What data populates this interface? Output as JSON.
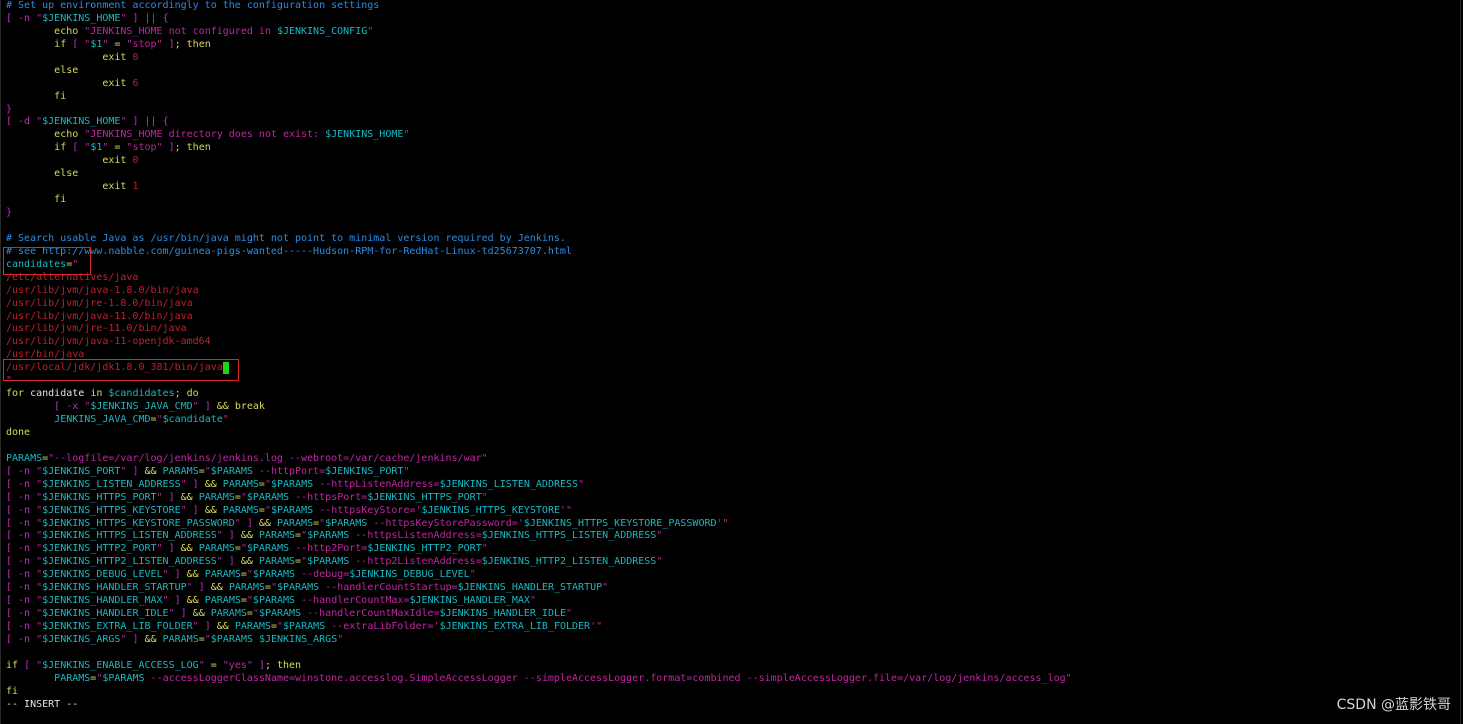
{
  "editor": {
    "mode_label": "-- INSERT --",
    "colors": {
      "background": "#000000",
      "comment": "#2b8ce6",
      "bracket": "#bd2fbd",
      "keyword": "#d9d95a",
      "string": "#c026a0",
      "variable": "#19b9c3",
      "java_path": "#c2212b",
      "cursor": "#1fd11f",
      "highlight_box": "#d42a2a"
    },
    "lines": [
      [
        [
          "cm",
          "# Set up environment accordingly to the configuration settings"
        ]
      ],
      [
        [
          "br",
          "[ -n "
        ],
        [
          "str",
          "\""
        ],
        [
          "var",
          "$JENKINS_HOME"
        ],
        [
          "str",
          "\""
        ],
        [
          "br",
          " ] || {"
        ]
      ],
      [
        [
          "w",
          "        "
        ],
        [
          "kw",
          "echo "
        ],
        [
          "str",
          "\"JENKINS_HOME not configured in "
        ],
        [
          "var",
          "$JENKINS_CONFIG"
        ],
        [
          "str",
          "\""
        ]
      ],
      [
        [
          "w",
          "        "
        ],
        [
          "kw",
          "if "
        ],
        [
          "br",
          "[ "
        ],
        [
          "str",
          "\""
        ],
        [
          "var",
          "$1"
        ],
        [
          "str",
          "\""
        ],
        [
          "kw",
          " = "
        ],
        [
          "str",
          "\"stop\""
        ],
        [
          "br",
          " ]"
        ],
        [
          "kw",
          "; then"
        ]
      ],
      [
        [
          "w",
          "                "
        ],
        [
          "kw",
          "exit "
        ],
        [
          "red",
          "0"
        ]
      ],
      [
        [
          "w",
          "        "
        ],
        [
          "kw",
          "else"
        ]
      ],
      [
        [
          "w",
          "                "
        ],
        [
          "kw",
          "exit "
        ],
        [
          "red",
          "6"
        ]
      ],
      [
        [
          "w",
          "        "
        ],
        [
          "kw",
          "fi"
        ]
      ],
      [
        [
          "br",
          "}"
        ]
      ],
      [
        [
          "br",
          "[ -d "
        ],
        [
          "str",
          "\""
        ],
        [
          "var",
          "$JENKINS_HOME"
        ],
        [
          "str",
          "\""
        ],
        [
          "br",
          " ] || {"
        ]
      ],
      [
        [
          "w",
          "        "
        ],
        [
          "kw",
          "echo "
        ],
        [
          "str",
          "\"JENKINS_HOME directory does not exist: "
        ],
        [
          "var",
          "$JENKINS_HOME"
        ],
        [
          "str",
          "\""
        ]
      ],
      [
        [
          "w",
          "        "
        ],
        [
          "kw",
          "if "
        ],
        [
          "br",
          "[ "
        ],
        [
          "str",
          "\""
        ],
        [
          "var",
          "$1"
        ],
        [
          "str",
          "\""
        ],
        [
          "kw",
          " = "
        ],
        [
          "str",
          "\"stop\""
        ],
        [
          "br",
          " ]"
        ],
        [
          "kw",
          "; then"
        ]
      ],
      [
        [
          "w",
          "                "
        ],
        [
          "kw",
          "exit "
        ],
        [
          "red",
          "0"
        ]
      ],
      [
        [
          "w",
          "        "
        ],
        [
          "kw",
          "else"
        ]
      ],
      [
        [
          "w",
          "                "
        ],
        [
          "kw",
          "exit "
        ],
        [
          "red",
          "1"
        ]
      ],
      [
        [
          "w",
          "        "
        ],
        [
          "kw",
          "fi"
        ]
      ],
      [
        [
          "br",
          "}"
        ]
      ],
      [],
      [
        [
          "cm",
          "# Search usable Java as /usr/bin/java might not point to minimal version required by Jenkins."
        ]
      ],
      [
        [
          "cm",
          "# see http://www.nabble.com/guinea-pigs-wanted-----Hudson-RPM-for-RedHat-Linux-td25673707.html"
        ]
      ],
      [
        [
          "var",
          "candidates"
        ],
        [
          "kw",
          "="
        ],
        [
          "str",
          "\""
        ]
      ],
      [
        [
          "red",
          "/etc/alternatives/java"
        ]
      ],
      [
        [
          "red",
          "/usr/lib/jvm/java-1.8.0/bin/java"
        ]
      ],
      [
        [
          "red",
          "/usr/lib/jvm/jre-1.8.0/bin/java"
        ]
      ],
      [
        [
          "red",
          "/usr/lib/jvm/java-11.0/bin/java"
        ]
      ],
      [
        [
          "red",
          "/usr/lib/jvm/jre-11.0/bin/java"
        ]
      ],
      [
        [
          "red",
          "/usr/lib/jvm/java-11-openjdk-amd64"
        ]
      ],
      [
        [
          "red",
          "/usr/bin/java"
        ]
      ],
      [
        [
          "red",
          "/usr/local/jdk/jdk1.8.0_381/bin/java"
        ],
        [
          "cursor",
          ""
        ]
      ],
      [
        [
          "str",
          "\""
        ]
      ],
      [
        [
          "kw",
          "for "
        ],
        [
          "w",
          "candidate "
        ],
        [
          "kw",
          "in "
        ],
        [
          "var",
          "$candidates"
        ],
        [
          "kw",
          "; do"
        ]
      ],
      [
        [
          "w",
          "        "
        ],
        [
          "br",
          "[ -x "
        ],
        [
          "str",
          "\""
        ],
        [
          "var",
          "$JENKINS_JAVA_CMD"
        ],
        [
          "str",
          "\""
        ],
        [
          "br",
          " ]"
        ],
        [
          "kw",
          " && break"
        ]
      ],
      [
        [
          "w",
          "        "
        ],
        [
          "var",
          "JENKINS_JAVA_CMD"
        ],
        [
          "kw",
          "="
        ],
        [
          "str",
          "\""
        ],
        [
          "var",
          "$candidate"
        ],
        [
          "str",
          "\""
        ]
      ],
      [
        [
          "kw",
          "done"
        ]
      ],
      [],
      [
        [
          "var",
          "PARAMS"
        ],
        [
          "kw",
          "="
        ],
        [
          "str",
          "\"--logfile=/var/log/jenkins/jenkins.log --webroot=/var/cache/jenkins/war\""
        ]
      ],
      [
        [
          "br",
          "[ -n "
        ],
        [
          "str",
          "\""
        ],
        [
          "var",
          "$JENKINS_PORT"
        ],
        [
          "str",
          "\""
        ],
        [
          "br",
          " ]"
        ],
        [
          "kw",
          " && "
        ],
        [
          "var",
          "PARAMS"
        ],
        [
          "kw",
          "="
        ],
        [
          "str",
          "\""
        ],
        [
          "var",
          "$PARAMS"
        ],
        [
          "str",
          " --httpPort="
        ],
        [
          "var",
          "$JENKINS_PORT"
        ],
        [
          "str",
          "\""
        ]
      ],
      [
        [
          "br",
          "[ -n "
        ],
        [
          "str",
          "\""
        ],
        [
          "var",
          "$JENKINS_LISTEN_ADDRESS"
        ],
        [
          "str",
          "\""
        ],
        [
          "br",
          " ]"
        ],
        [
          "kw",
          " && "
        ],
        [
          "var",
          "PARAMS"
        ],
        [
          "kw",
          "="
        ],
        [
          "str",
          "\""
        ],
        [
          "var",
          "$PARAMS"
        ],
        [
          "str",
          " --httpListenAddress="
        ],
        [
          "var",
          "$JENKINS_LISTEN_ADDRESS"
        ],
        [
          "str",
          "\""
        ]
      ],
      [
        [
          "br",
          "[ -n "
        ],
        [
          "str",
          "\""
        ],
        [
          "var",
          "$JENKINS_HTTPS_PORT"
        ],
        [
          "str",
          "\""
        ],
        [
          "br",
          " ]"
        ],
        [
          "kw",
          " && "
        ],
        [
          "var",
          "PARAMS"
        ],
        [
          "kw",
          "="
        ],
        [
          "str",
          "\""
        ],
        [
          "var",
          "$PARAMS"
        ],
        [
          "str",
          " --httpsPort="
        ],
        [
          "var",
          "$JENKINS_HTTPS_PORT"
        ],
        [
          "str",
          "\""
        ]
      ],
      [
        [
          "br",
          "[ -n "
        ],
        [
          "str",
          "\""
        ],
        [
          "var",
          "$JENKINS_HTTPS_KEYSTORE"
        ],
        [
          "str",
          "\""
        ],
        [
          "br",
          " ]"
        ],
        [
          "kw",
          " && "
        ],
        [
          "var",
          "PARAMS"
        ],
        [
          "kw",
          "="
        ],
        [
          "str",
          "\""
        ],
        [
          "var",
          "$PARAMS"
        ],
        [
          "str",
          " --httpsKeyStore='"
        ],
        [
          "var",
          "$JENKINS_HTTPS_KEYSTORE"
        ],
        [
          "str",
          "'\""
        ]
      ],
      [
        [
          "br",
          "[ -n "
        ],
        [
          "str",
          "\""
        ],
        [
          "var",
          "$JENKINS_HTTPS_KEYSTORE_PASSWORD"
        ],
        [
          "str",
          "\""
        ],
        [
          "br",
          " ]"
        ],
        [
          "kw",
          " && "
        ],
        [
          "var",
          "PARAMS"
        ],
        [
          "kw",
          "="
        ],
        [
          "str",
          "\""
        ],
        [
          "var",
          "$PARAMS"
        ],
        [
          "str",
          " --httpsKeyStorePassword='"
        ],
        [
          "var",
          "$JENKINS_HTTPS_KEYSTORE_PASSWORD"
        ],
        [
          "str",
          "'\""
        ]
      ],
      [
        [
          "br",
          "[ -n "
        ],
        [
          "str",
          "\""
        ],
        [
          "var",
          "$JENKINS_HTTPS_LISTEN_ADDRESS"
        ],
        [
          "str",
          "\""
        ],
        [
          "br",
          " ]"
        ],
        [
          "kw",
          " && "
        ],
        [
          "var",
          "PARAMS"
        ],
        [
          "kw",
          "="
        ],
        [
          "str",
          "\""
        ],
        [
          "var",
          "$PARAMS"
        ],
        [
          "str",
          " --httpsListenAddress="
        ],
        [
          "var",
          "$JENKINS_HTTPS_LISTEN_ADDRESS"
        ],
        [
          "str",
          "\""
        ]
      ],
      [
        [
          "br",
          "[ -n "
        ],
        [
          "str",
          "\""
        ],
        [
          "var",
          "$JENKINS_HTTP2_PORT"
        ],
        [
          "str",
          "\""
        ],
        [
          "br",
          " ]"
        ],
        [
          "kw",
          " && "
        ],
        [
          "var",
          "PARAMS"
        ],
        [
          "kw",
          "="
        ],
        [
          "str",
          "\""
        ],
        [
          "var",
          "$PARAMS"
        ],
        [
          "str",
          " --http2Port="
        ],
        [
          "var",
          "$JENKINS_HTTP2_PORT"
        ],
        [
          "str",
          "\""
        ]
      ],
      [
        [
          "br",
          "[ -n "
        ],
        [
          "str",
          "\""
        ],
        [
          "var",
          "$JENKINS_HTTP2_LISTEN_ADDRESS"
        ],
        [
          "str",
          "\""
        ],
        [
          "br",
          " ]"
        ],
        [
          "kw",
          " && "
        ],
        [
          "var",
          "PARAMS"
        ],
        [
          "kw",
          "="
        ],
        [
          "str",
          "\""
        ],
        [
          "var",
          "$PARAMS"
        ],
        [
          "str",
          " --http2ListenAddress="
        ],
        [
          "var",
          "$JENKINS_HTTP2_LISTEN_ADDRESS"
        ],
        [
          "str",
          "\""
        ]
      ],
      [
        [
          "br",
          "[ -n "
        ],
        [
          "str",
          "\""
        ],
        [
          "var",
          "$JENKINS_DEBUG_LEVEL"
        ],
        [
          "str",
          "\""
        ],
        [
          "br",
          " ]"
        ],
        [
          "kw",
          " && "
        ],
        [
          "var",
          "PARAMS"
        ],
        [
          "kw",
          "="
        ],
        [
          "str",
          "\""
        ],
        [
          "var",
          "$PARAMS"
        ],
        [
          "str",
          " --debug="
        ],
        [
          "var",
          "$JENKINS_DEBUG_LEVEL"
        ],
        [
          "str",
          "\""
        ]
      ],
      [
        [
          "br",
          "[ -n "
        ],
        [
          "str",
          "\""
        ],
        [
          "var",
          "$JENKINS_HANDLER_STARTUP"
        ],
        [
          "str",
          "\""
        ],
        [
          "br",
          " ]"
        ],
        [
          "kw",
          " && "
        ],
        [
          "var",
          "PARAMS"
        ],
        [
          "kw",
          "="
        ],
        [
          "str",
          "\""
        ],
        [
          "var",
          "$PARAMS"
        ],
        [
          "str",
          " --handlerCountStartup="
        ],
        [
          "var",
          "$JENKINS_HANDLER_STARTUP"
        ],
        [
          "str",
          "\""
        ]
      ],
      [
        [
          "br",
          "[ -n "
        ],
        [
          "str",
          "\""
        ],
        [
          "var",
          "$JENKINS_HANDLER_MAX"
        ],
        [
          "str",
          "\""
        ],
        [
          "br",
          " ]"
        ],
        [
          "kw",
          " && "
        ],
        [
          "var",
          "PARAMS"
        ],
        [
          "kw",
          "="
        ],
        [
          "str",
          "\""
        ],
        [
          "var",
          "$PARAMS"
        ],
        [
          "str",
          " --handlerCountMax="
        ],
        [
          "var",
          "$JENKINS_HANDLER_MAX"
        ],
        [
          "str",
          "\""
        ]
      ],
      [
        [
          "br",
          "[ -n "
        ],
        [
          "str",
          "\""
        ],
        [
          "var",
          "$JENKINS_HANDLER_IDLE"
        ],
        [
          "str",
          "\""
        ],
        [
          "br",
          " ]"
        ],
        [
          "kw",
          " && "
        ],
        [
          "var",
          "PARAMS"
        ],
        [
          "kw",
          "="
        ],
        [
          "str",
          "\""
        ],
        [
          "var",
          "$PARAMS"
        ],
        [
          "str",
          " --handlerCountMaxIdle="
        ],
        [
          "var",
          "$JENKINS_HANDLER_IDLE"
        ],
        [
          "str",
          "\""
        ]
      ],
      [
        [
          "br",
          "[ -n "
        ],
        [
          "str",
          "\""
        ],
        [
          "var",
          "$JENKINS_EXTRA_LIB_FOLDER"
        ],
        [
          "str",
          "\""
        ],
        [
          "br",
          " ]"
        ],
        [
          "kw",
          " && "
        ],
        [
          "var",
          "PARAMS"
        ],
        [
          "kw",
          "="
        ],
        [
          "str",
          "\""
        ],
        [
          "var",
          "$PARAMS"
        ],
        [
          "str",
          " --extraLibFolder='"
        ],
        [
          "var",
          "$JENKINS_EXTRA_LIB_FOLDER"
        ],
        [
          "str",
          "'\""
        ]
      ],
      [
        [
          "br",
          "[ -n "
        ],
        [
          "str",
          "\""
        ],
        [
          "var",
          "$JENKINS_ARGS"
        ],
        [
          "str",
          "\""
        ],
        [
          "br",
          " ]"
        ],
        [
          "kw",
          " && "
        ],
        [
          "var",
          "PARAMS"
        ],
        [
          "kw",
          "="
        ],
        [
          "str",
          "\""
        ],
        [
          "var",
          "$PARAMS $JENKINS_ARGS"
        ],
        [
          "str",
          "\""
        ]
      ],
      [],
      [
        [
          "kw",
          "if "
        ],
        [
          "br",
          "[ "
        ],
        [
          "str",
          "\""
        ],
        [
          "var",
          "$JENKINS_ENABLE_ACCESS_LOG"
        ],
        [
          "str",
          "\""
        ],
        [
          "kw",
          " = "
        ],
        [
          "str",
          "\"yes\""
        ],
        [
          "br",
          " ]"
        ],
        [
          "kw",
          "; then"
        ]
      ],
      [
        [
          "w",
          "        "
        ],
        [
          "var",
          "PARAMS"
        ],
        [
          "kw",
          "="
        ],
        [
          "str",
          "\""
        ],
        [
          "var",
          "$PARAMS"
        ],
        [
          "str",
          " --accessLoggerClassName=winstone.accesslog.SimpleAccessLogger --simpleAccessLogger.format=combined --simpleAccessLogger.file=/var/log/jenkins/access_log\""
        ]
      ],
      [
        [
          "kw",
          "fi"
        ]
      ],
      [
        [
          "w",
          "-- INSERT --"
        ]
      ]
    ]
  },
  "watermark": "CSDN @蓝影铁哥"
}
